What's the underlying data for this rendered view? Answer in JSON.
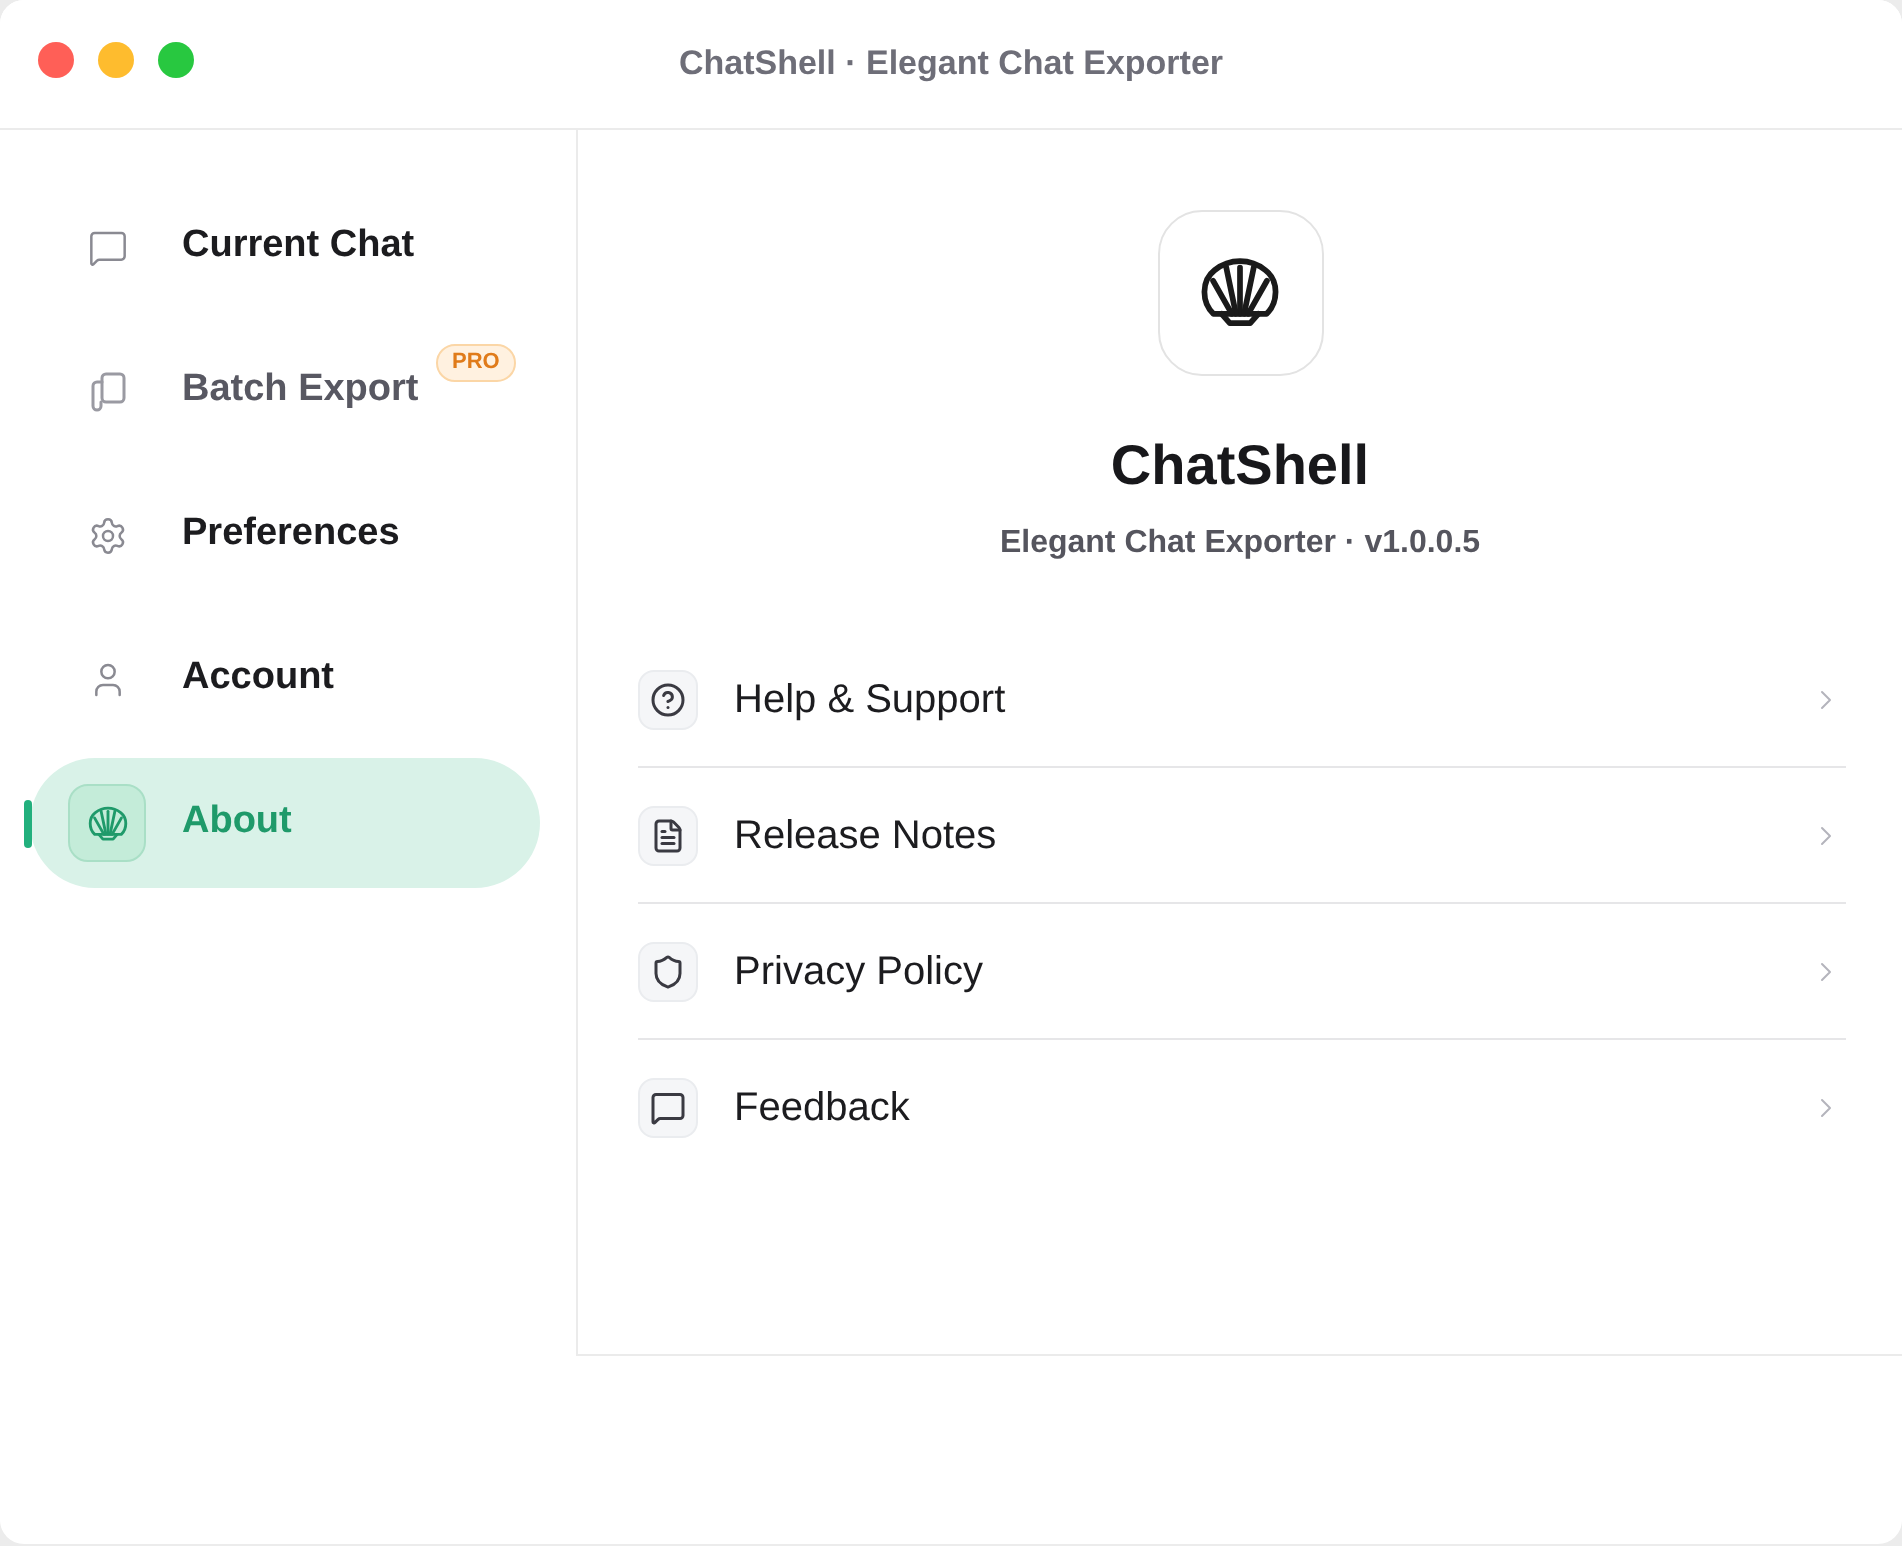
{
  "window": {
    "title": "ChatShell · Elegant Chat Exporter"
  },
  "sidebar": {
    "items": [
      {
        "label": "Current Chat",
        "selected": false,
        "disabled": false
      },
      {
        "label": "Batch Export",
        "selected": false,
        "disabled": true,
        "badge": "PRO"
      },
      {
        "label": "Preferences",
        "selected": false,
        "disabled": false
      },
      {
        "label": "Account",
        "selected": false,
        "disabled": false
      },
      {
        "label": "About",
        "selected": true,
        "disabled": false
      }
    ]
  },
  "about": {
    "app_name": "ChatShell",
    "subtitle": "Elegant Chat Exporter · v1.0.0.5",
    "links": [
      {
        "label": "Help & Support"
      },
      {
        "label": "Release Notes"
      },
      {
        "label": "Privacy Policy"
      },
      {
        "label": "Feedback"
      }
    ]
  }
}
